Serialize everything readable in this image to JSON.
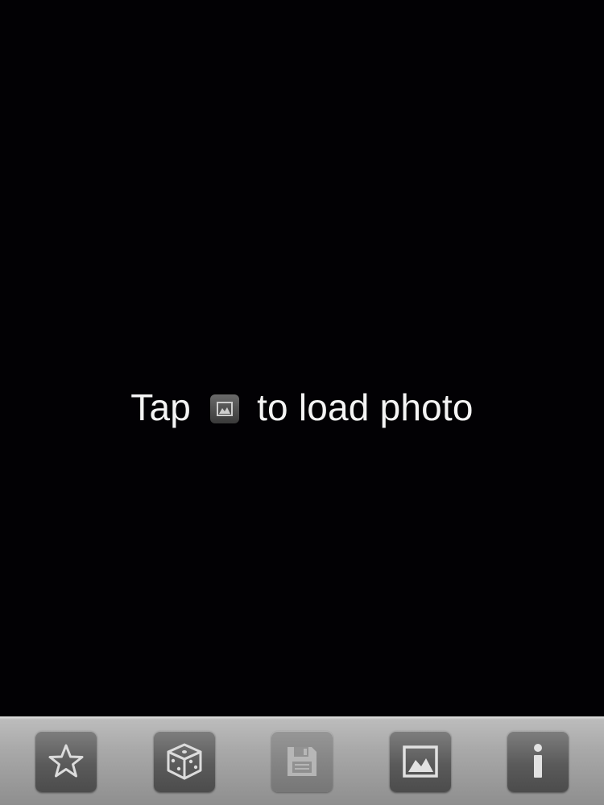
{
  "hint": {
    "before": "Tap",
    "after": "to load photo",
    "inline_icon": "photo-icon"
  },
  "toolbar": {
    "buttons": [
      {
        "icon": "star-icon",
        "enabled": true
      },
      {
        "icon": "dice-icon",
        "enabled": true
      },
      {
        "icon": "floppy-disk-icon",
        "enabled": false
      },
      {
        "icon": "photo-icon",
        "enabled": true
      },
      {
        "icon": "info-icon",
        "enabled": true
      }
    ]
  },
  "colors": {
    "background": "#020104",
    "text": "#f4f4f4",
    "toolbar": "#a9a9a9"
  }
}
